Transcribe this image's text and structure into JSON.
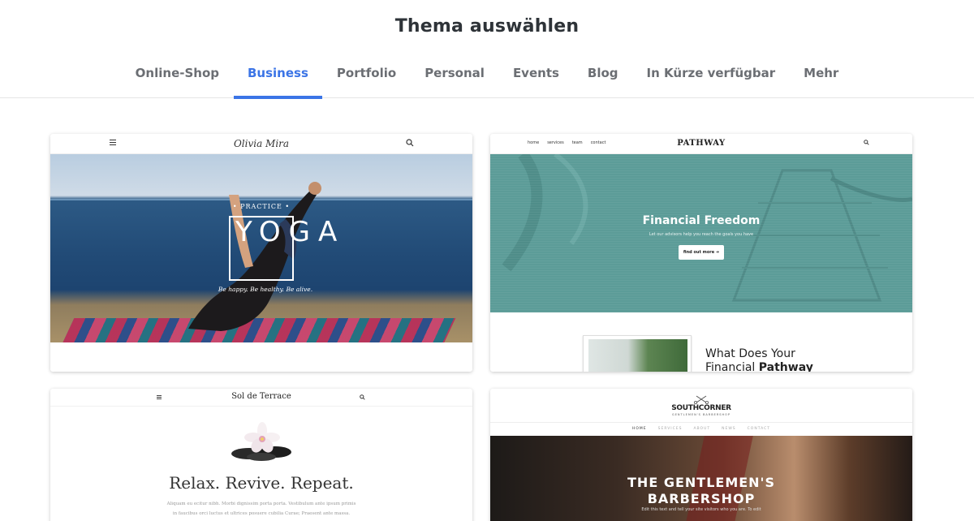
{
  "page_title": "Thema auswählen",
  "tabs": [
    {
      "label": "Online-Shop",
      "active": false
    },
    {
      "label": "Business",
      "active": true
    },
    {
      "label": "Portfolio",
      "active": false
    },
    {
      "label": "Personal",
      "active": false
    },
    {
      "label": "Events",
      "active": false
    },
    {
      "label": "Blog",
      "active": false
    },
    {
      "label": "In Kürze verfügbar",
      "active": false
    },
    {
      "label": "Mehr",
      "active": false
    }
  ],
  "colors": {
    "accent": "#3b74e6",
    "tab_text": "#6b6e73",
    "title_text": "#2e3338"
  },
  "templates": {
    "yoga": {
      "logo": "Olivia Mira",
      "practice": "• PRACTICE •",
      "headline": "YOGA",
      "tagline": "Be happy. Be healthy. Be alive."
    },
    "pathway": {
      "nav": [
        "home",
        "services",
        "team",
        "contact"
      ],
      "logo": "PATHWAY",
      "headline": "Financial Freedom",
      "subline": "Let our advisors help you reach the goals you have",
      "button": "find out more",
      "section_line1": "What Does Your",
      "section_line2_prefix": "Financial ",
      "section_line2_bold": "Pathway"
    },
    "terrace": {
      "logo": "Sol de Terrace",
      "headline": "Relax. Revive. Repeat.",
      "body_line1": "Aliquam eu ecitur nibh. Morbi dignissim porta porta. Vestibulum ante ipsum primis",
      "body_line2": "in faucibus orci luctus et ultrices posuere cubilia Curae; Praesent ante massa."
    },
    "barber": {
      "logo": "SOUTHCORNER",
      "logo_sub": "GENTLEMEN'S BARBERSHOP",
      "nav": [
        {
          "label": "HOME",
          "selected": true
        },
        {
          "label": "SERVICES",
          "selected": false
        },
        {
          "label": "ABOUT",
          "selected": false
        },
        {
          "label": "NEWS",
          "selected": false
        },
        {
          "label": "CONTACT",
          "selected": false
        }
      ],
      "headline_line1": "THE GENTLEMEN'S",
      "headline_line2": "BARBERSHOP",
      "subline": "Edit this text and tell your site visitors who you are. To edit"
    }
  }
}
